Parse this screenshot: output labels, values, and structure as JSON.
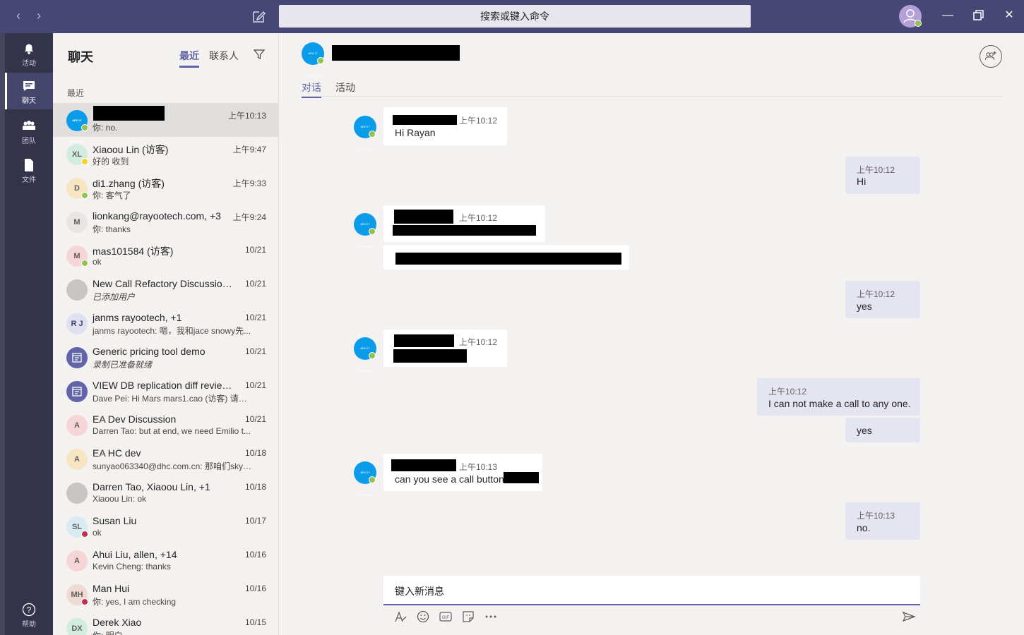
{
  "search": {
    "placeholder": "搜索或键入命令"
  },
  "titlebar": {
    "back_icon": "chevron-left-icon",
    "forward_icon": "chevron-right-icon"
  },
  "rail": [
    {
      "label": "活动",
      "icon": "bell-icon"
    },
    {
      "label": "聊天",
      "icon": "chat-icon"
    },
    {
      "label": "团队",
      "icon": "teams-icon"
    },
    {
      "label": "文件",
      "icon": "file-icon"
    }
  ],
  "rail_help": {
    "label": "帮助"
  },
  "list": {
    "title": "聊天",
    "tabs": [
      "最近",
      "联系人"
    ],
    "section": "最近",
    "chats": [
      {
        "name": "",
        "preview": "你: no.",
        "time": "上午10:13",
        "initials": "",
        "redacted": true
      },
      {
        "name": "Xiaoou Lin (访客)",
        "preview": "好的 收到",
        "time": "上午9:47",
        "initials": "XL"
      },
      {
        "name": "di1.zhang (访客)",
        "preview": "你: 客气了",
        "time": "上午9:33",
        "initials": "D"
      },
      {
        "name": "lionkang@rayootech.com, +3",
        "preview": "你: thanks",
        "time": "上午9:24",
        "initials": "M"
      },
      {
        "name": "mas101584 (访客)",
        "preview": "ok",
        "time": "10/21",
        "initials": "M"
      },
      {
        "name": "New Call Refactory Discussion ...",
        "preview": "已添加用户",
        "time": "10/21",
        "initials": "",
        "italic": true
      },
      {
        "name": "janms rayootech, +1",
        "preview": "janms rayootech: 嗯，我和jace snowy先...",
        "time": "10/21",
        "initials": "R J"
      },
      {
        "name": "Generic pricing tool demo",
        "preview": "录制已准备就绪",
        "time": "10/21",
        "initials": "",
        "italic": true
      },
      {
        "name": "VIEW DB replication diff review ...",
        "preview": "Dave Pei: Hi Mars mars1.cao (访客) 请提...",
        "time": "10/21",
        "initials": ""
      },
      {
        "name": "EA Dev Discussion",
        "preview": "Darren Tao: but at end, we need Emilio t...",
        "time": "10/21",
        "initials": "A"
      },
      {
        "name": "EA HC dev",
        "preview": "sunyao063340@dhc.com.cn: 那咱们skyp...",
        "time": "10/18",
        "initials": "A"
      },
      {
        "name": "Darren Tao, Xiaoou Lin, +1",
        "preview": "Xiaoou Lin: ok",
        "time": "10/18",
        "initials": ""
      },
      {
        "name": "Susan Liu",
        "preview": "ok",
        "time": "10/17",
        "initials": "SL"
      },
      {
        "name": "Ahui Liu, allen, +14",
        "preview": "Kevin Cheng: thanks",
        "time": "10/16",
        "initials": "A"
      },
      {
        "name": "Man Hui",
        "preview": "你: yes, I am checking",
        "time": "10/16",
        "initials": "MH"
      },
      {
        "name": "Derek Xiao",
        "preview": "你: 明白",
        "time": "10/15",
        "initials": "DX"
      }
    ]
  },
  "conversation": {
    "tabs": [
      "对话",
      "活动"
    ],
    "avatar_text": "ARO IT SUPPORT",
    "messages": [
      {
        "side": "in",
        "time": "上午10:12",
        "text": "Hi Rayan"
      },
      {
        "side": "out",
        "time": "上午10:12",
        "text": "Hi"
      },
      {
        "side": "in",
        "time": "上午10:12",
        "text": ""
      },
      {
        "side": "out",
        "time": "上午10:12",
        "text": "yes"
      },
      {
        "side": "in",
        "time": "上午10:12",
        "text": ""
      },
      {
        "side": "out",
        "time": "上午10:12",
        "text": "I can not make a call to any one."
      },
      {
        "side": "out",
        "time": "",
        "text": "yes"
      },
      {
        "side": "in",
        "time": "上午10:13",
        "text": "can you see a call button"
      },
      {
        "side": "out",
        "time": "上午10:13",
        "text": "no."
      }
    ]
  },
  "compose": {
    "placeholder": "键入新消息"
  },
  "colors": {
    "accent": "#6264a7",
    "titlebar": "#464775",
    "rail": "#33344a",
    "available": "#92c353"
  }
}
